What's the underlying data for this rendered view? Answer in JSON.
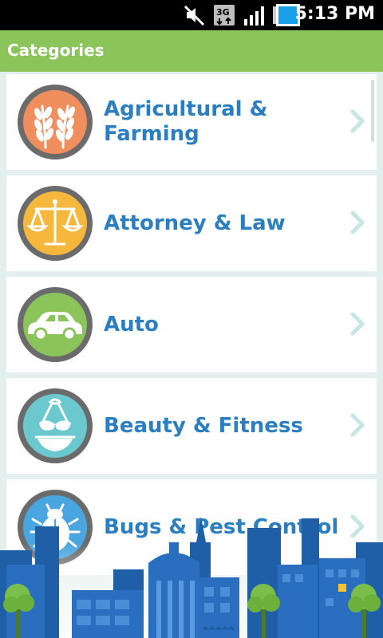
{
  "status_bar": {
    "time": "5:13 PM",
    "network": "3G"
  },
  "header": {
    "title": "Categories"
  },
  "categories": [
    {
      "label": "Agricultural & Farming",
      "icon": "wheat-icon",
      "color": "#f08e5e"
    },
    {
      "label": "Attorney & Law",
      "icon": "scales-icon",
      "color": "#f6b83c"
    },
    {
      "label": "Auto",
      "icon": "car-icon",
      "color": "#8bc45a"
    },
    {
      "label": "Beauty & Fitness",
      "icon": "bikini-icon",
      "color": "#6cc8cf"
    },
    {
      "label": "Bugs & Pest Control",
      "icon": "bug-icon",
      "color": "#4aa6e0"
    }
  ],
  "colors": {
    "accent": "#8bc45a",
    "label": "#2b7fc0",
    "chevron": "#c5e6e2",
    "background": "#e3efec"
  }
}
